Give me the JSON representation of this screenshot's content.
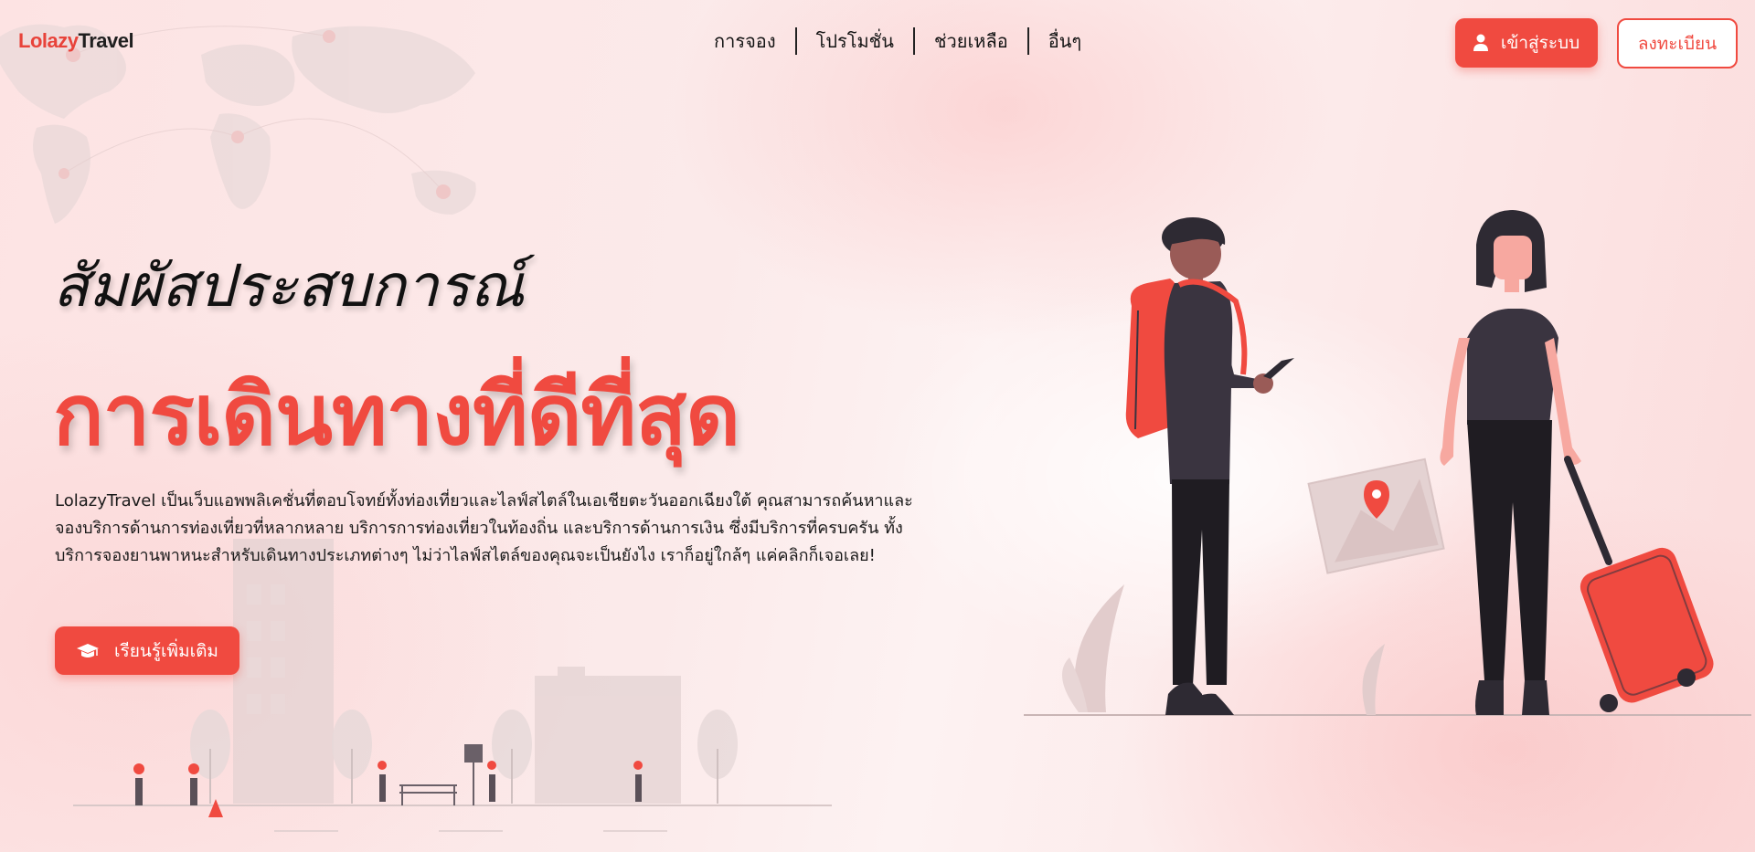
{
  "brand": {
    "part1": "Lolazy",
    "part2": "Travel"
  },
  "nav": {
    "items": [
      {
        "label": "การจอง"
      },
      {
        "label": "โปรโมชั่น"
      },
      {
        "label": "ช่วยเหลือ"
      },
      {
        "label": "อื่นๆ"
      }
    ]
  },
  "auth": {
    "login_label": "เข้าสู่ระบบ",
    "register_label": "ลงทะเบียน"
  },
  "hero": {
    "subtitle": "สัมผัสประสบการณ์",
    "title": "การเดินทางที่ดีที่สุด",
    "description": "LolazyTravel เป็นเว็บแอพพลิเคชั่นที่ตอบโจทย์ทั้งท่องเที่ยวและไลฟ์สไตล์ในเอเชียตะวันออกเฉียงใต้ คุณสามารถค้นหาและจองบริการด้านการท่องเที่ยวที่หลากหลาย บริการการท่องเที่ยวในท้องถิ่น และบริการด้านการเงิน ซึ่งมีบริการที่ครบครัน ทั้งบริการจองยานพาหนะสำหรับเดินทางประเภทต่างๆ ไม่ว่าไลฟ์สไตล์ของคุณจะเป็นยังไง เราก็อยู่ใกล้ๆ แค่คลิกก็เจอเลย!",
    "learn_more_label": "เรียนรู้เพิ่มเติม"
  },
  "icons": {
    "login": "user-icon",
    "learn_more": "graduation-cap-icon"
  },
  "colors": {
    "accent": "#f04a40",
    "text": "#141414",
    "figure_dark": "#3a3440",
    "skin_light": "#f7a8a0",
    "skin_dark": "#9a5b57"
  }
}
